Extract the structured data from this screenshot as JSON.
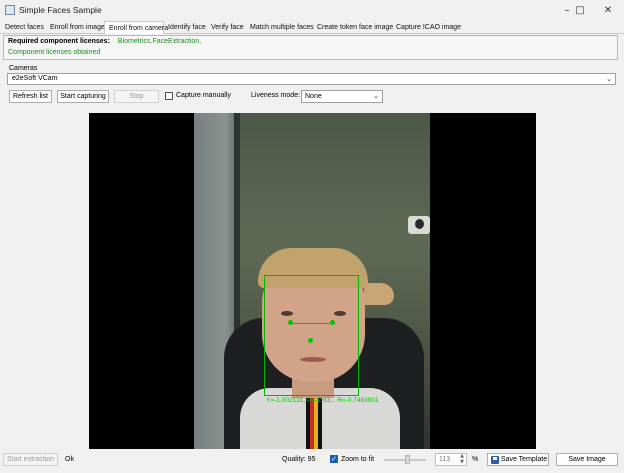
{
  "window": {
    "title": "Simple Faces Sample",
    "controls": {
      "minimize": "–",
      "maximize": "□",
      "close": "✕"
    }
  },
  "tabs": [
    {
      "label": "Detect faces",
      "active": false
    },
    {
      "label": "Enroll from image",
      "active": false
    },
    {
      "label": "Enroll from camera",
      "active": true
    },
    {
      "label": "Identify face",
      "active": false
    },
    {
      "label": "Verify face",
      "active": false
    },
    {
      "label": "Match multiple faces",
      "active": false
    },
    {
      "label": "Create token face image",
      "active": false
    },
    {
      "label": "Capture ICAO image",
      "active": false
    }
  ],
  "licenses": {
    "required_label": "Required component licenses:",
    "component": "Biometrics.FaceExtraction,",
    "status": "Component licenses obtained"
  },
  "cameras": {
    "group_label": "Cameras",
    "selected": "e2eSoft VCam",
    "refresh_button": "Refresh list",
    "start_button": "Start capturing",
    "stop_button": "Stop",
    "capture_manually_label": "Capture manually",
    "capture_manually_checked": false,
    "liveness_label": "Liveness mode:",
    "liveness_value": "None"
  },
  "viewer": {
    "detection_text": "Y=-1.002131, P=-2.63... R=-0.7483901"
  },
  "footer": {
    "start_extraction": "Start extraction",
    "status": "Ok",
    "quality": "Quality: 95",
    "zoom_to_fit_label": "Zoom to fit",
    "zoom_to_fit_checked": true,
    "zoom_value": "113",
    "zoom_unit": "%",
    "save_template": "Save Template",
    "save_image": "Save Image"
  },
  "icons": {
    "app": "app-icon",
    "dropdown": "chevron-down-icon",
    "save": "floppy-disk-icon",
    "check": "checkmark-icon"
  },
  "colors": {
    "license_ok": "#1a8f1a",
    "detection": "#00c800",
    "checkbox_checked": "#1a5fb4"
  }
}
